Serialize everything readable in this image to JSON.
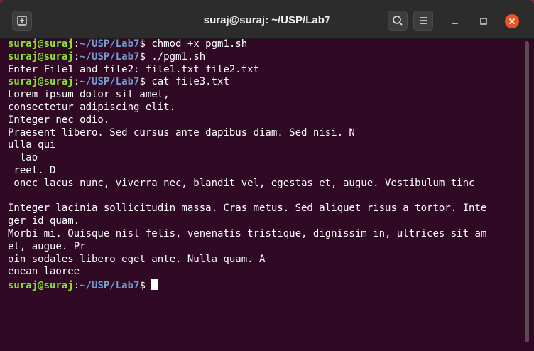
{
  "window": {
    "title": "suraj@suraj: ~/USP/Lab7"
  },
  "colors": {
    "terminal_bg": "#300a24",
    "prompt_user": "#8ae234",
    "prompt_path": "#729fcf",
    "close_button": "#e95420"
  },
  "icons": {
    "new_tab": "new-tab-icon",
    "search": "search-icon",
    "menu": "hamburger-menu-icon",
    "minimize": "minimize-icon",
    "maximize": "maximize-icon",
    "close": "close-icon"
  },
  "prompt": {
    "user": "suraj@suraj",
    "path": "~/USP/Lab7"
  },
  "lines": [
    {
      "type": "cmd",
      "text": "chmod +x pgm1.sh"
    },
    {
      "type": "cmd",
      "text": "./pgm1.sh"
    },
    {
      "type": "out",
      "text": "Enter File1 and file2: file1.txt file2.txt"
    },
    {
      "type": "cmd",
      "text": "cat file3.txt"
    },
    {
      "type": "out",
      "text": "Lorem ipsum dolor sit amet,"
    },
    {
      "type": "out",
      "text": "consectetur adipiscing elit."
    },
    {
      "type": "out",
      "text": "Integer nec odio."
    },
    {
      "type": "out",
      "text": "Praesent libero. Sed cursus ante dapibus diam. Sed nisi. N"
    },
    {
      "type": "out",
      "text": "ulla qui"
    },
    {
      "type": "out",
      "text": "  lao"
    },
    {
      "type": "out",
      "text": " reet. D"
    },
    {
      "type": "out",
      "text": " onec lacus nunc, viverra nec, blandit vel, egestas et, augue. Vestibulum tinc"
    },
    {
      "type": "out",
      "text": ""
    },
    {
      "type": "out",
      "text": "Integer lacinia sollicitudin massa. Cras metus. Sed aliquet risus a tortor. Inte"
    },
    {
      "type": "out",
      "text": "ger id quam."
    },
    {
      "type": "out",
      "text": "Morbi mi. Quisque nisl felis, venenatis tristique, dignissim in, ultrices sit am"
    },
    {
      "type": "out",
      "text": "et, augue. Pr"
    },
    {
      "type": "out",
      "text": "oin sodales libero eget ante. Nulla quam. A"
    },
    {
      "type": "out",
      "text": "enean laoree"
    },
    {
      "type": "cmd",
      "text": ""
    }
  ]
}
